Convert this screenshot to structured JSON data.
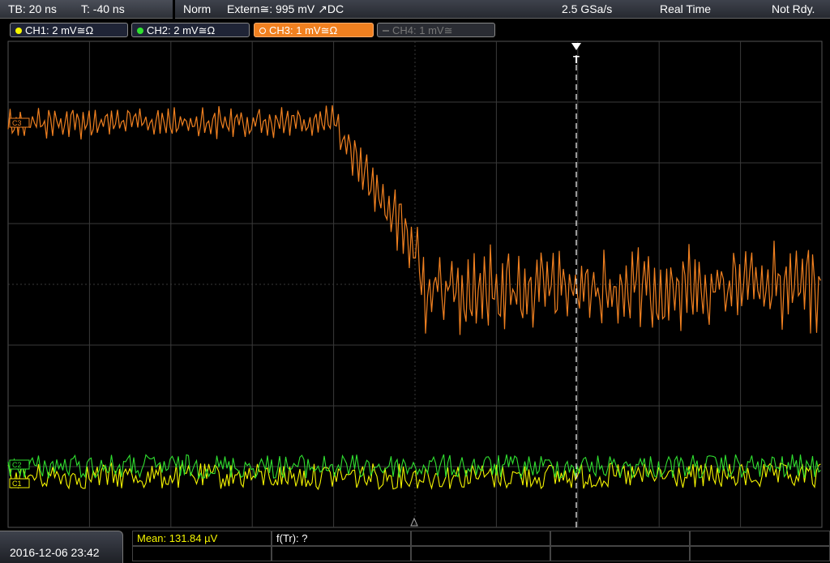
{
  "header": {
    "timebase": "TB: 20 ns",
    "trigger_offset": "T: -40 ns",
    "mode": "Norm",
    "trigger_source": "Extern≅: 995 mV ↗DC",
    "sample_rate": "2.5 GSa/s",
    "acq_mode": "Real Time",
    "status": "Not Rdy."
  },
  "channels": [
    {
      "label": "CH1: 2 mV≅Ω",
      "color": "#f5f500",
      "active": true
    },
    {
      "label": "CH2: 2 mV≅Ω",
      "color": "#30e030",
      "active": true
    },
    {
      "label": "CH3: 1 mV≅Ω",
      "color": "#f08020",
      "active": true,
      "selected": true
    },
    {
      "label": "CH4: 1 mV≅",
      "color": "#777777",
      "active": false
    }
  ],
  "markers": {
    "ch1": "C1",
    "ch2": "C2",
    "ch3": "C3",
    "trigger": "T"
  },
  "footer": {
    "datetime": "2016-12-06 23:42",
    "measurement_mean": "Mean: 131.84 µV",
    "measurement_ftr": "f(Tr): ?"
  },
  "colors": {
    "grid": "#3a3a3a",
    "background": "#000000"
  }
}
